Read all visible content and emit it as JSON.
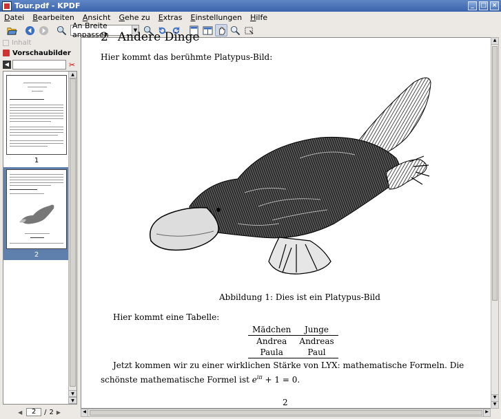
{
  "window": {
    "title": "Tour.pdf - KPDF"
  },
  "menu": [
    "Datei",
    "Bearbeiten",
    "Ansicht",
    "Gehe zu",
    "Extras",
    "Einstellungen",
    "Hilfe"
  ],
  "toolbar": {
    "zoom_value": "An Breite anpassen"
  },
  "sidebar": {
    "tab_contents": "Inhalt",
    "tab_thumbnails": "Vorschaubilder",
    "thumbnails": [
      {
        "number": "1"
      },
      {
        "number": "2"
      }
    ],
    "selected_page": "2"
  },
  "pagenav": {
    "current": "2",
    "separator": "/",
    "total": "2"
  },
  "document": {
    "section_number": "2",
    "section_title": "Andere Dinge",
    "para1": "Hier kommt das berühmte Platypus-Bild:",
    "caption": "Abbildung 1: Dies ist ein Platypus-Bild",
    "para2": "Hier kommt eine Tabelle:",
    "table": {
      "headers": [
        "Mädchen",
        "Junge"
      ],
      "rows": [
        [
          "Andrea",
          "Andreas"
        ],
        [
          "Paula",
          "Paul"
        ]
      ]
    },
    "para3_a": "Jetzt kommen wir zu einer wirklichen Stärke von LYX: mathematische Formeln. Die schönste mathematische Formel ist ",
    "para3_formula": "e",
    "para3_exp": "iπ",
    "para3_b": " + 1 = 0.",
    "page_number": "2"
  }
}
